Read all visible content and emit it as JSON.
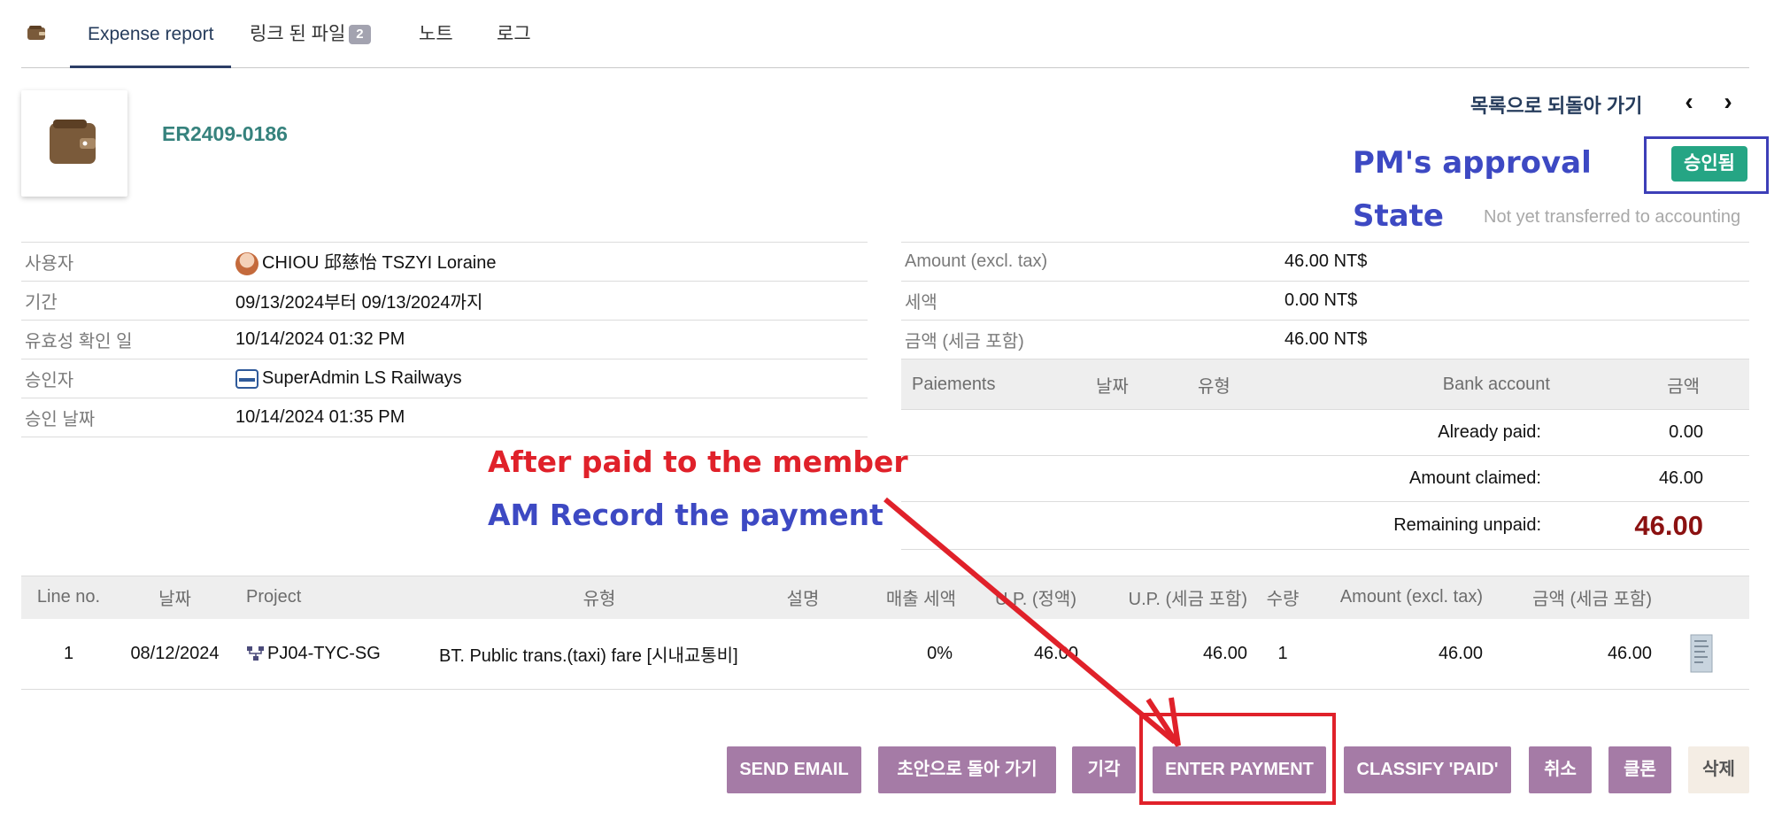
{
  "tabs": [
    {
      "label": "Expense report",
      "active": true
    },
    {
      "label": "링크 된 파일",
      "badge": "2"
    },
    {
      "label": "노트"
    },
    {
      "label": "로그"
    }
  ],
  "header": {
    "ref": "ER2409-0186",
    "back_to_list": "목록으로 되돌아 가기",
    "status": "승인됨",
    "accounting_note": "Not yet transferred to accounting"
  },
  "left_fields": [
    {
      "label": "사용자",
      "value": "CHIOU 邱慈怡 TSZYI Loraine"
    },
    {
      "label": "기간",
      "value": "09/13/2024부터 09/13/2024까지"
    },
    {
      "label": "유효성 확인 일",
      "value": "10/14/2024 01:32 PM"
    },
    {
      "label": "승인자",
      "value": "SuperAdmin LS Railways"
    },
    {
      "label": "승인 날짜",
      "value": "10/14/2024 01:35 PM"
    }
  ],
  "right_fields": [
    {
      "label": "Amount (excl. tax)",
      "value": "46.00 NT$"
    },
    {
      "label": "세액",
      "value": "0.00 NT$"
    },
    {
      "label": "금액 (세금 포함)",
      "value": "46.00 NT$"
    }
  ],
  "payments": {
    "headers": [
      "Paiements",
      "날짜",
      "유형",
      "Bank account",
      "금액"
    ],
    "already_paid_label": "Already paid:",
    "already_paid": "0.00",
    "claimed_label": "Amount claimed:",
    "claimed": "46.00",
    "remaining_label": "Remaining unpaid:",
    "remaining": "46.00"
  },
  "lines": {
    "headers": [
      "Line no.",
      "날짜",
      "Project",
      "유형",
      "설명",
      "매출 세액",
      "U.P. (정액)",
      "U.P. (세금 포함)",
      "수량",
      "Amount (excl. tax)",
      "금액 (세금 포함)"
    ],
    "rows": [
      {
        "no": "1",
        "date": "08/12/2024",
        "project": "PJ04-TYC-SG",
        "type": "BT. Public trans.(taxi) fare [시내교통비]",
        "desc": "",
        "vat": "0%",
        "up_ht": "46.00",
        "up_ttc": "46.00",
        "qty": "1",
        "amount_ht": "46.00",
        "amount_ttc": "46.00"
      }
    ]
  },
  "buttons": {
    "send_email": "SEND EMAIL",
    "back_draft": "초안으로 돌아 가기",
    "refuse": "기각",
    "enter_payment": "ENTER PAYMENT",
    "classify_paid": "CLASSIFY 'PAID'",
    "cancel": "취소",
    "clone": "클론",
    "delete": "삭제"
  },
  "annotations": {
    "pm_line1": "PM's approval",
    "pm_line2": "State",
    "am_line1": "After paid to the member",
    "am_line2": "AM Record the payment"
  },
  "colors": {
    "accent_purple": "#a57ba6",
    "status_green": "#25a584",
    "annotation_red": "#e0212a",
    "annotation_blue": "#3d49c3",
    "ref_teal": "#36827d",
    "remaining_red": "#8b1111"
  },
  "icons": {
    "tab_icon": "wallet-icon",
    "header_icon": "wallet-icon",
    "project_icon": "project-tree-icon",
    "line_file_icon": "document-thumbnail-icon"
  }
}
